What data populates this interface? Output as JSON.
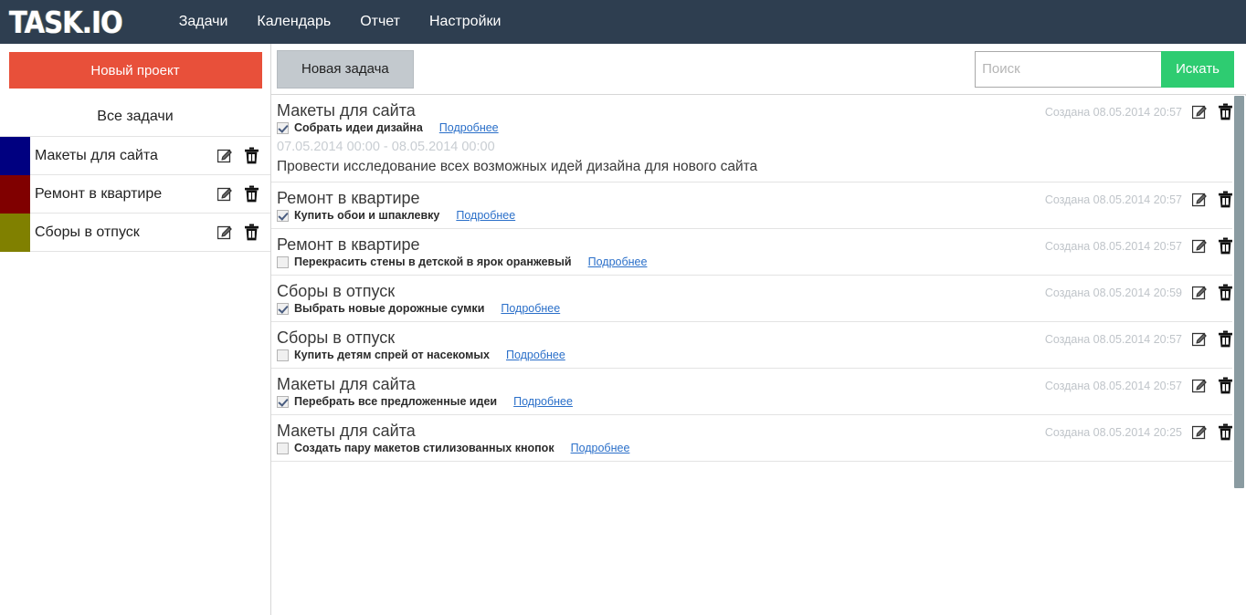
{
  "app": {
    "logo": "TASK.IO",
    "nav": [
      {
        "label": "Задачи"
      },
      {
        "label": "Календарь"
      },
      {
        "label": "Отчет"
      },
      {
        "label": "Настройки"
      }
    ]
  },
  "sidebar": {
    "new_project_label": "Новый проект",
    "all_tasks_label": "Все задачи",
    "projects": [
      {
        "name": "Макеты для сайта",
        "color": "#000080"
      },
      {
        "name": "Ремонт в квартире",
        "color": "#800000"
      },
      {
        "name": "Сборы в отпуск",
        "color": "#808000"
      }
    ],
    "edit_icon": "edit-icon",
    "delete_icon": "trash-icon"
  },
  "toolbar": {
    "new_task_label": "Новая задача",
    "search_placeholder": "Поиск",
    "search_value": "",
    "search_button_label": "Искать"
  },
  "colors": {
    "navbar": "#2e3e50",
    "new_project": "#e8503a",
    "search_button": "#2ecc71",
    "link": "#2a6fc9"
  },
  "tasks": [
    {
      "project": "Макеты для сайта",
      "checked": true,
      "text": "Собрать идеи дизайна",
      "more_label": "Подробнее",
      "created": "Создана 08.05.2014 20:57",
      "dates": "07.05.2014 00:00 - 08.05.2014 00:00",
      "description": "Провести исследование всех возможных идей дизайна для нового сайта"
    },
    {
      "project": "Ремонт в квартире",
      "checked": true,
      "text": "Купить обои и шпаклевку",
      "more_label": "Подробнее",
      "created": "Создана 08.05.2014 20:57",
      "dates": "",
      "description": ""
    },
    {
      "project": "Ремонт в квартире",
      "checked": false,
      "text": "Перекрасить стены в детской в ярок оранжевый",
      "more_label": "Подробнее",
      "created": "Создана 08.05.2014 20:57",
      "dates": "",
      "description": ""
    },
    {
      "project": "Сборы в отпуск",
      "checked": true,
      "text": "Выбрать новые дорожные сумки",
      "more_label": "Подробнее",
      "created": "Создана 08.05.2014 20:59",
      "dates": "",
      "description": ""
    },
    {
      "project": "Сборы в отпуск",
      "checked": false,
      "text": "Купить детям спрей от насекомых",
      "more_label": "Подробнее",
      "created": "Создана 08.05.2014 20:57",
      "dates": "",
      "description": ""
    },
    {
      "project": "Макеты для сайта",
      "checked": true,
      "text": "Перебрать все предложенные идеи",
      "more_label": "Подробнее",
      "created": "Создана 08.05.2014 20:57",
      "dates": "",
      "description": ""
    },
    {
      "project": "Макеты для сайта",
      "checked": false,
      "text": "Создать пару макетов стилизованных кнопок",
      "more_label": "Подробнее",
      "created": "Создана 08.05.2014 20:25",
      "dates": "",
      "description": ""
    }
  ]
}
